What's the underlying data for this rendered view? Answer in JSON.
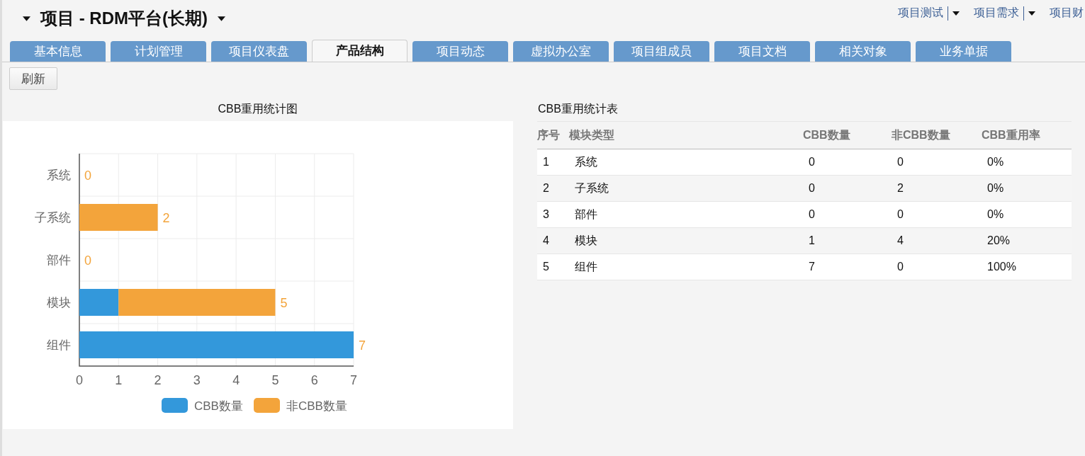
{
  "header": {
    "title": "项目 - RDM平台(长期)",
    "links": [
      {
        "label": "项目测试",
        "has_menu": true
      },
      {
        "label": "项目需求",
        "has_menu": true
      },
      {
        "label": "项目财",
        "has_menu": false
      }
    ]
  },
  "tabs": [
    {
      "label": "基本信息",
      "selected": false
    },
    {
      "label": "计划管理",
      "selected": false
    },
    {
      "label": "项目仪表盘",
      "selected": false
    },
    {
      "label": "产品结构",
      "selected": true
    },
    {
      "label": "项目动态",
      "selected": false
    },
    {
      "label": "虚拟办公室",
      "selected": false
    },
    {
      "label": "项目组成员",
      "selected": false
    },
    {
      "label": "项目文档",
      "selected": false
    },
    {
      "label": "相关对象",
      "selected": false
    },
    {
      "label": "业务单据",
      "selected": false
    }
  ],
  "toolbar": {
    "buttons": [
      "刷新"
    ]
  },
  "chart_panel": {
    "title": "CBB重用统计图",
    "chart_data": {
      "type": "bar",
      "orientation": "horizontal",
      "stacked": true,
      "categories": [
        "系统",
        "子系统",
        "部件",
        "模块",
        "组件"
      ],
      "series": [
        {
          "name": "CBB数量",
          "color": "#3398db",
          "values": [
            0,
            0,
            0,
            1,
            7
          ]
        },
        {
          "name": "非CBB数量",
          "color": "#f3a43b",
          "values": [
            0,
            2,
            0,
            4,
            0
          ]
        }
      ],
      "grid": true,
      "legend": true,
      "xlim": [
        0,
        7
      ],
      "xticks": [
        0,
        1,
        2,
        3,
        4,
        5,
        6,
        7
      ],
      "value_labels": [
        "0",
        "2",
        "0",
        "5",
        "7"
      ]
    }
  },
  "table_panel": {
    "title": "CBB重用统计表",
    "columns": [
      "序号",
      "模块类型",
      "CBB数量",
      "非CBB数量",
      "CBB重用率"
    ],
    "rows": [
      [
        "1",
        "系统",
        "0",
        "0",
        "0%"
      ],
      [
        "2",
        "子系统",
        "0",
        "2",
        "0%"
      ],
      [
        "3",
        "部件",
        "0",
        "0",
        "0%"
      ],
      [
        "4",
        "模块",
        "1",
        "4",
        "20%"
      ],
      [
        "5",
        "组件",
        "7",
        "0",
        "100%"
      ]
    ]
  }
}
